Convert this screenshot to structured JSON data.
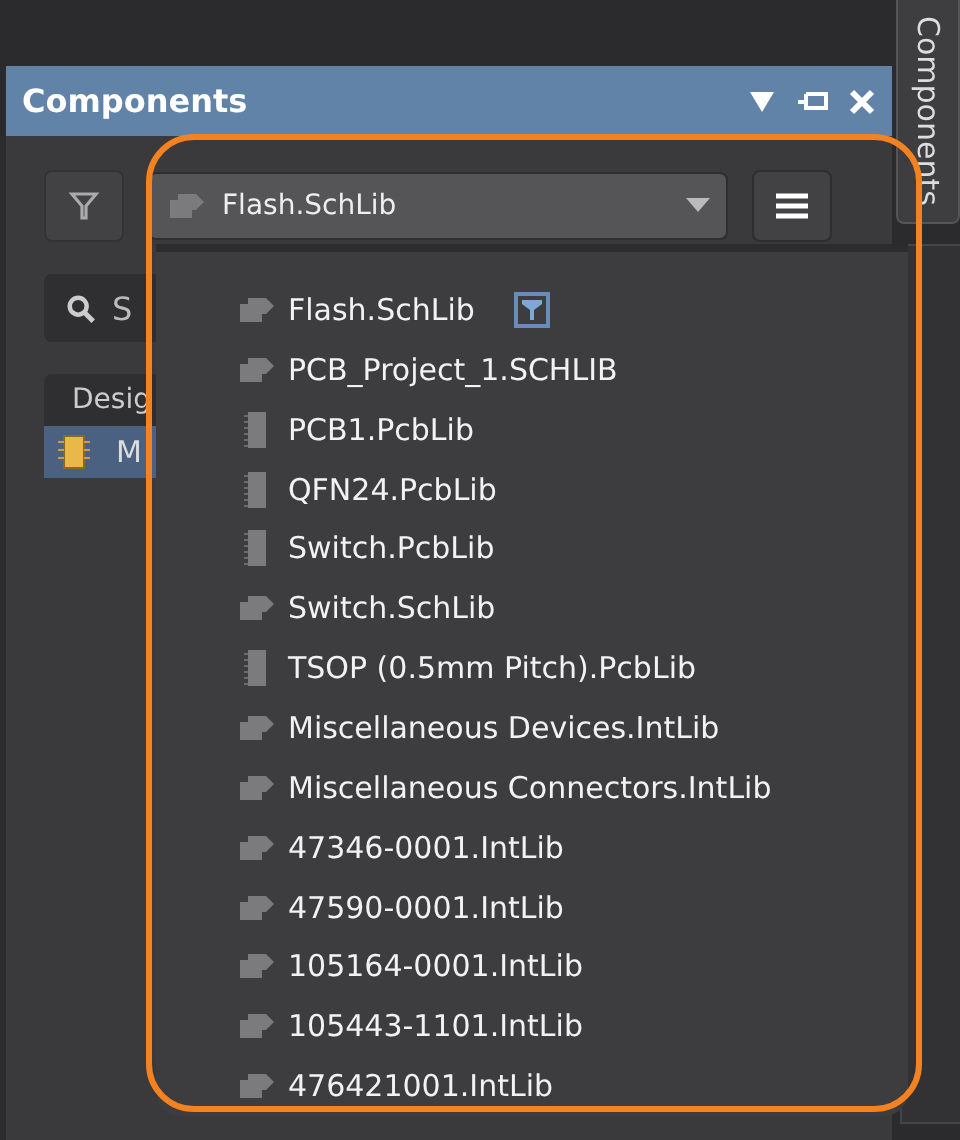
{
  "side_tab": {
    "label": "Components",
    "selected": true
  },
  "panel": {
    "title": "Components"
  },
  "library_dropdown": {
    "value": "Flash.SchLib",
    "kind": "sch"
  },
  "search": {
    "placeholder": "S"
  },
  "table": {
    "columns": [
      "Desig"
    ],
    "rows": [
      {
        "cell": "M",
        "selected": true
      }
    ]
  },
  "dropdown_list": {
    "items": [
      {
        "label": "Flash.SchLib",
        "kind": "sch",
        "filtered": true
      },
      {
        "label": "PCB_Project_1.SCHLIB",
        "kind": "sch",
        "filtered": false
      },
      {
        "label": "PCB1.PcbLib",
        "kind": "pcb",
        "filtered": false
      },
      {
        "label": "QFN24.PcbLib",
        "kind": "pcb",
        "filtered": false
      },
      {
        "label": "Switch.PcbLib",
        "kind": "pcb",
        "filtered": false
      },
      {
        "label": "Switch.SchLib",
        "kind": "sch",
        "filtered": false
      },
      {
        "label": "TSOP (0.5mm Pitch).PcbLib",
        "kind": "pcb",
        "filtered": false
      },
      {
        "label": "Miscellaneous Devices.IntLib",
        "kind": "sch",
        "filtered": false
      },
      {
        "label": "Miscellaneous Connectors.IntLib",
        "kind": "sch",
        "filtered": false
      },
      {
        "label": "47346-0001.IntLib",
        "kind": "sch",
        "filtered": false
      },
      {
        "label": "47590-0001.IntLib",
        "kind": "sch",
        "filtered": false
      },
      {
        "label": "105164-0001.IntLib",
        "kind": "sch",
        "filtered": false
      },
      {
        "label": "105443-1101.IntLib",
        "kind": "sch",
        "filtered": false
      },
      {
        "label": "476421001.IntLib",
        "kind": "sch",
        "filtered": false
      }
    ]
  }
}
